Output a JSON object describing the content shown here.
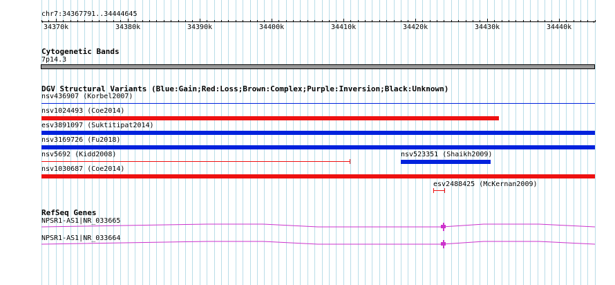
{
  "ruler": {
    "coordinates": "chr7:34367791..34444645",
    "ticks": [
      "34370k",
      "34380k",
      "34390k",
      "34400k",
      "34410k",
      "34420k",
      "34430k",
      "34440k"
    ]
  },
  "cytoband": {
    "title": "Cytogenetic Bands",
    "band": "7p14.3"
  },
  "dgv": {
    "title": "DGV Structural Variants (Blue:Gain;Red:Loss;Brown:Complex;Purple:Inversion;Black:Unknown)",
    "features": [
      {
        "label": "nsv436907 (Korbel2007)",
        "type": "gain"
      },
      {
        "label": "nsv1024493 (Coe2014)",
        "type": "loss"
      },
      {
        "label": "esv3891097 (Suktitipat2014)",
        "type": "gain"
      },
      {
        "label": "nsv3169726 (Fu2018)",
        "type": "gain"
      },
      {
        "label": "nsv5692 (Kidd2008)",
        "type": "loss"
      },
      {
        "label": "nsv523351 (Shaikh2009)",
        "type": "gain"
      },
      {
        "label": "nsv1030687 (Coe2014)",
        "type": "loss"
      },
      {
        "label": "esv2488425 (McKernan2009)",
        "type": "loss"
      }
    ]
  },
  "refseq": {
    "title": "RefSeq Genes",
    "genes": [
      {
        "label": "NPSR1-AS1|NR_033665"
      },
      {
        "label": "NPSR1-AS1|NR_033664"
      }
    ]
  },
  "colors": {
    "gain": "#0022dd",
    "loss": "#ee1111",
    "gene": "#cc33cc",
    "grid": "#b9dde8",
    "band": "#999999"
  }
}
